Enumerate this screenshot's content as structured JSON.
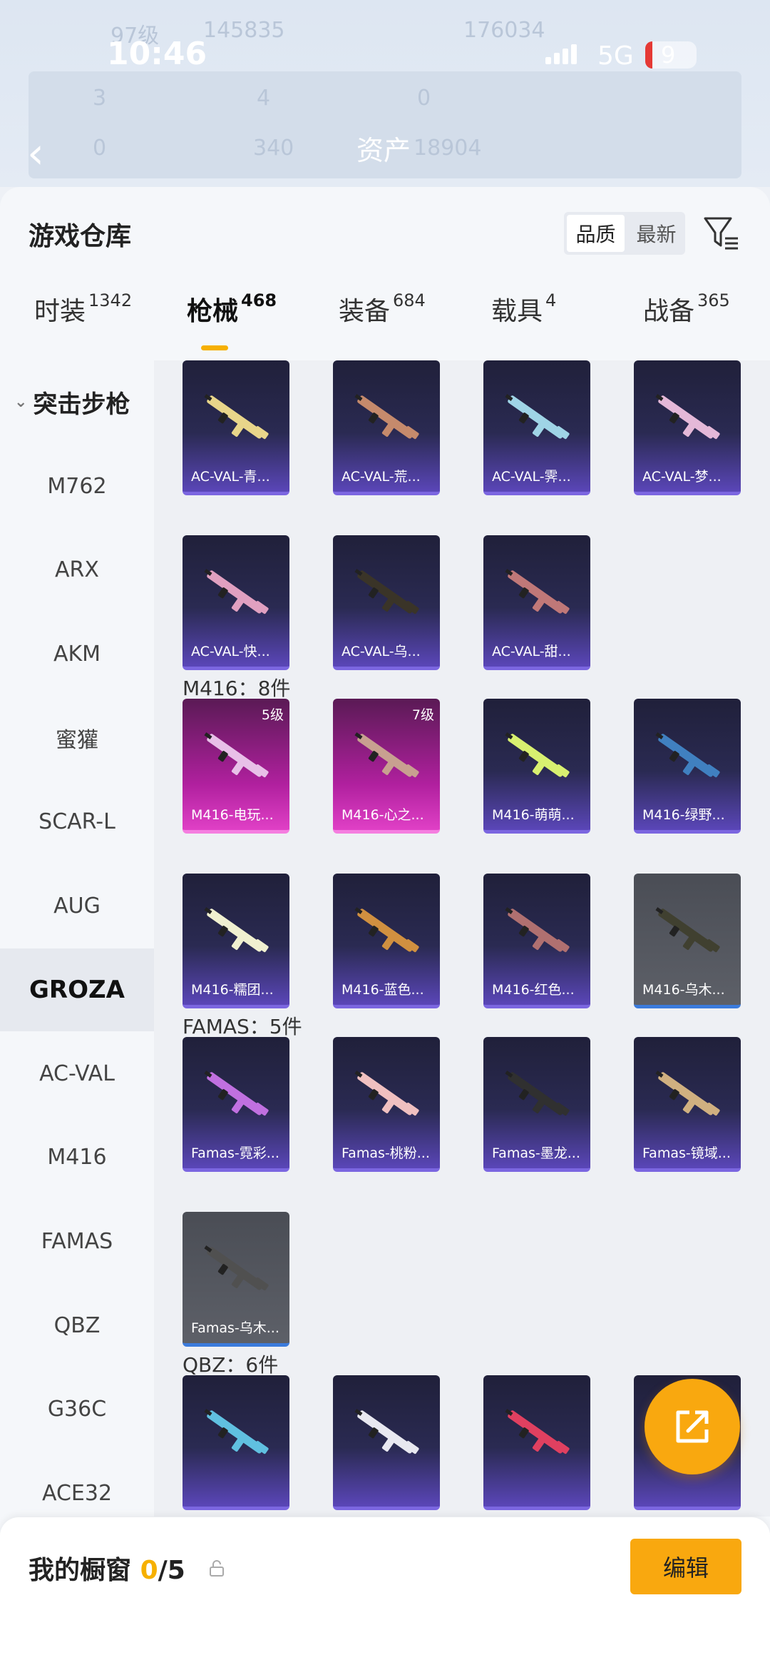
{
  "status": {
    "time": "10:46",
    "network": "5G",
    "battery": "9"
  },
  "background_header": {
    "level": "97级",
    "id": "145835",
    "id2": "176034",
    "stats": [
      "3",
      "4",
      "0",
      "0",
      "340"
    ],
    "assets_label": "资产",
    "assets_value": "18904"
  },
  "header": {
    "title": "游戏仓库",
    "sort_options": [
      "品质",
      "最新"
    ],
    "sort_selected": "品质"
  },
  "tabs": [
    {
      "label": "时装",
      "count": "1342"
    },
    {
      "label": "枪械",
      "count": "468"
    },
    {
      "label": "装备",
      "count": "684"
    },
    {
      "label": "载具",
      "count": "4"
    },
    {
      "label": "战备",
      "count": "365"
    }
  ],
  "active_tab": "枪械",
  "sidebar": {
    "group": "突击步枪",
    "items": [
      "M762",
      "ARX",
      "AKM",
      "蜜獾",
      "SCAR-L",
      "AUG",
      "GROZA",
      "AC-VAL",
      "M416",
      "FAMAS",
      "QBZ",
      "G36C",
      "ACE32"
    ],
    "selected": "GROZA"
  },
  "sections": [
    {
      "title": "",
      "items": [
        {
          "name": "AC-VAL-青...",
          "rarity": "purple"
        },
        {
          "name": "AC-VAL-荒...",
          "rarity": "purple"
        },
        {
          "name": "AC-VAL-霁...",
          "rarity": "purple"
        },
        {
          "name": "AC-VAL-梦...",
          "rarity": "purple"
        },
        {
          "name": "AC-VAL-快...",
          "rarity": "purple"
        },
        {
          "name": "AC-VAL-乌...",
          "rarity": "purple"
        },
        {
          "name": "AC-VAL-甜...",
          "rarity": "purple"
        }
      ]
    },
    {
      "title": "M416：8件",
      "items": [
        {
          "name": "M416-电玩...",
          "rarity": "pink",
          "level": "5级"
        },
        {
          "name": "M416-心之...",
          "rarity": "pink",
          "level": "7级"
        },
        {
          "name": "M416-萌萌...",
          "rarity": "purple"
        },
        {
          "name": "M416-绿野...",
          "rarity": "purple"
        },
        {
          "name": "M416-糯团...",
          "rarity": "purple"
        },
        {
          "name": "M416-蓝色...",
          "rarity": "purple"
        },
        {
          "name": "M416-红色...",
          "rarity": "purple"
        },
        {
          "name": "M416-乌木...",
          "rarity": "grey"
        }
      ]
    },
    {
      "title": "FAMAS：5件",
      "items": [
        {
          "name": "Famas-霓彩...",
          "rarity": "purple"
        },
        {
          "name": "Famas-桃粉...",
          "rarity": "purple"
        },
        {
          "name": "Famas-墨龙...",
          "rarity": "purple"
        },
        {
          "name": "Famas-镜域...",
          "rarity": "purple"
        },
        {
          "name": "Famas-乌木...",
          "rarity": "grey"
        }
      ]
    },
    {
      "title": "QBZ：6件",
      "items": [
        {
          "name": "",
          "rarity": "purple"
        },
        {
          "name": "",
          "rarity": "purple"
        },
        {
          "name": "",
          "rarity": "purple"
        },
        {
          "name": "",
          "rarity": "purple"
        }
      ]
    }
  ],
  "showcase": {
    "label": "我的橱窗",
    "current": "0",
    "total": "/5",
    "edit_label": "编辑"
  },
  "colors": {
    "accent": "#f9a80f",
    "purple_rarity": "#7b66e0",
    "pink_rarity": "#e040c6"
  },
  "icons": {
    "filter": "filter-list-icon",
    "share": "share-external-icon",
    "lock": "lock-icon",
    "back": "chevron-left-icon"
  }
}
